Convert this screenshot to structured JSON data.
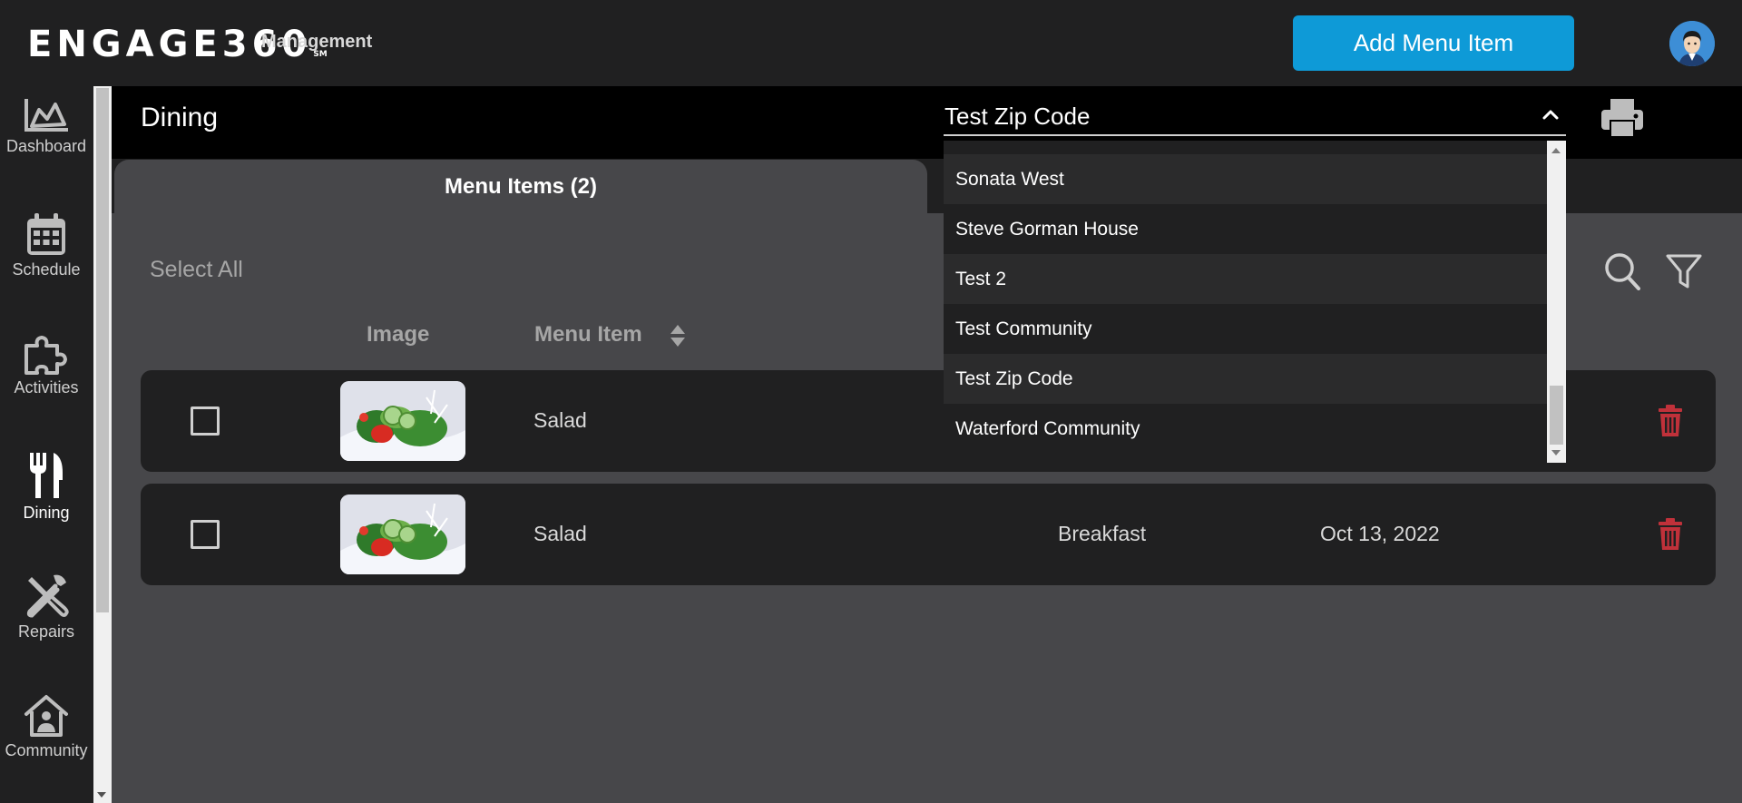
{
  "header": {
    "logo_text": "ENGAGE360",
    "logo_mark": "SM",
    "subtitle": "Management",
    "add_button_label": "Add Menu Item",
    "avatar_icon": "user-avatar-icon"
  },
  "sidebar": {
    "items": [
      {
        "label": "Dashboard",
        "icon": "chart-area-icon"
      },
      {
        "label": "Schedule",
        "icon": "calendar-icon"
      },
      {
        "label": "Activities",
        "icon": "puzzle-icon"
      },
      {
        "label": "Dining",
        "icon": "fork-knife-icon"
      },
      {
        "label": "Repairs",
        "icon": "tools-icon"
      },
      {
        "label": "Community",
        "icon": "house-user-icon"
      }
    ]
  },
  "page": {
    "title": "Dining",
    "print_icon": "printer-icon"
  },
  "community_select": {
    "value": "Test Zip Code",
    "expanded": true,
    "options": [
      "Sonata West",
      "Steve Gorman House",
      "Test 2",
      "Test Community",
      "Test Zip Code",
      "Waterford Community"
    ]
  },
  "tabs": {
    "active": "Menu Items (2)"
  },
  "toolbar": {
    "select_all": "Select All"
  },
  "table": {
    "columns": {
      "image": "Image",
      "menu_item": "Menu Item"
    },
    "rows": [
      {
        "name": "Salad",
        "meal": "",
        "date": ""
      },
      {
        "name": "Salad",
        "meal": "Breakfast",
        "date": "Oct 13, 2022"
      }
    ]
  },
  "colors": {
    "accent": "#0e9ad7",
    "danger": "#c0313a",
    "background": "#47474a",
    "panel": "#202021"
  }
}
